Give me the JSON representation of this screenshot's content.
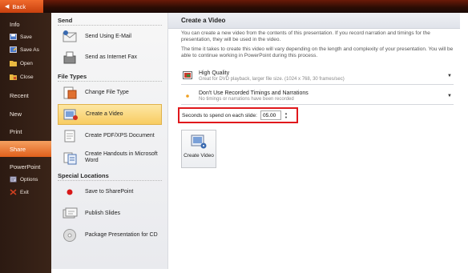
{
  "back": {
    "label": "Back"
  },
  "leftnav": {
    "items": [
      {
        "label": "Info"
      },
      {
        "label": "Save"
      },
      {
        "label": "Save As"
      },
      {
        "label": "Open"
      },
      {
        "label": "Close"
      },
      {
        "label": "Recent"
      },
      {
        "label": "New"
      },
      {
        "label": "Print"
      },
      {
        "label": "Share"
      },
      {
        "label": "PowerPoint"
      },
      {
        "label": "Options"
      },
      {
        "label": "Exit"
      }
    ]
  },
  "middle": {
    "send_heading": "Send",
    "send_items": [
      {
        "label": "Send Using E-Mail",
        "icon": "email-icon"
      },
      {
        "label": "Send as Internet Fax",
        "icon": "fax-icon"
      }
    ],
    "filetypes_heading": "File Types",
    "filetypes_items": [
      {
        "label": "Change File Type",
        "icon": "change-file-type-icon"
      },
      {
        "label": "Create a Video",
        "icon": "create-video-icon"
      },
      {
        "label": "Create PDF/XPS Document",
        "icon": "pdf-icon"
      },
      {
        "label": "Create Handouts in Microsoft Word",
        "icon": "handouts-icon"
      }
    ],
    "special_heading": "Special Locations",
    "special_items": [
      {
        "label": "Save to SharePoint",
        "icon": "sharepoint-icon"
      },
      {
        "label": "Publish Slides",
        "icon": "publish-slides-icon"
      },
      {
        "label": "Package Presentation for CD",
        "icon": "cd-icon"
      }
    ]
  },
  "right": {
    "title": "Create a Video",
    "desc1": "You can create a new video from the contents of this presentation. If you record narration and timings for the presentation, they will be used in the video.",
    "desc2": "The time it takes to create this video will vary depending on the length and complexity of your presentation. You will be able to continue working in PowerPoint during this process.",
    "quality": {
      "title": "High Quality",
      "subtitle": "Great for DVD playback, larger file size. (1024 x 768, 30 frames/sec)"
    },
    "timings": {
      "title": "Don't Use Recorded Timings and Narrations",
      "subtitle": "No timings or narrations have been recorded"
    },
    "seconds_label": "Seconds to spend on each slide:",
    "seconds_value": "05.00",
    "create_button": "Create Video"
  },
  "colors": {
    "accent": "#e0601c",
    "highlight": "#f8cc62",
    "callout": "#e0181c"
  }
}
